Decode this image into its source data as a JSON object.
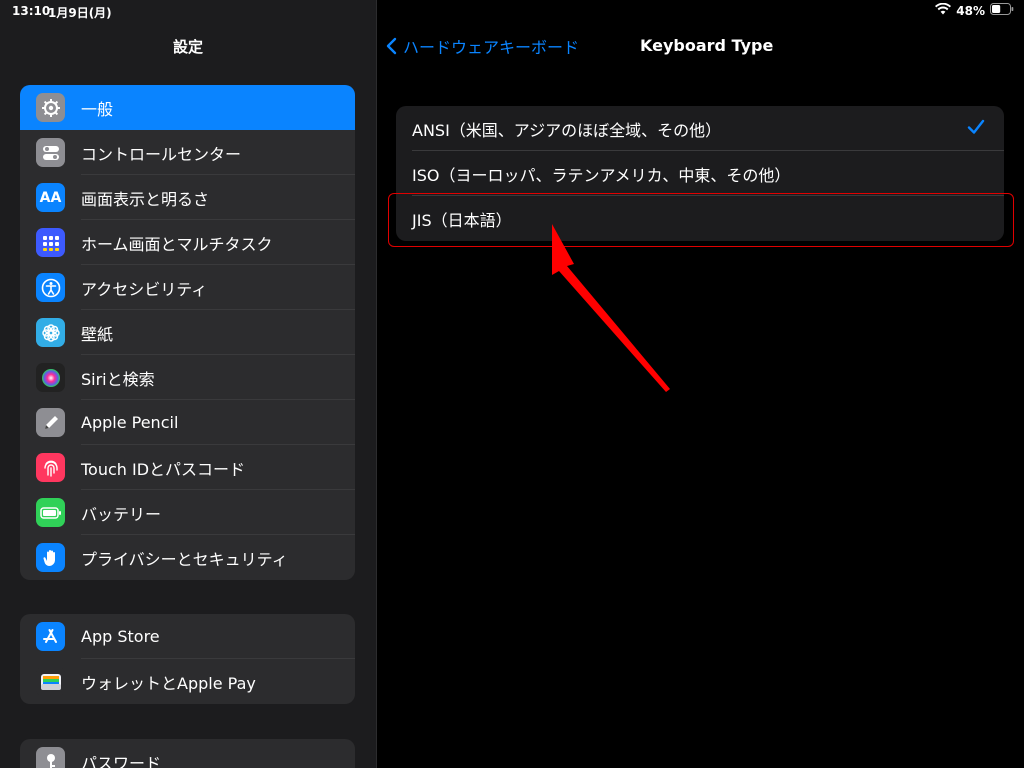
{
  "status": {
    "time": "13:10",
    "date": "1月9日(月)",
    "battery": "48%",
    "battery_level": 0.48
  },
  "sidebar": {
    "title": "設定",
    "groups": [
      {
        "items": [
          {
            "label": "一般",
            "icon": "gear-icon",
            "color": "#8e8e93",
            "selected": true
          },
          {
            "label": "コントロールセンター",
            "icon": "switches-icon",
            "color": "#8e8e93"
          },
          {
            "label": "画面表示と明るさ",
            "icon": "text-size-icon",
            "color": "#0a84ff",
            "icon_text": "AA"
          },
          {
            "label": "ホーム画面とマルチタスク",
            "icon": "home-grid-icon",
            "color": "#3d5afe"
          },
          {
            "label": "アクセシビリティ",
            "icon": "accessibility-icon",
            "color": "#0a84ff"
          },
          {
            "label": "壁紙",
            "icon": "flower-icon",
            "color": "#32ade6"
          },
          {
            "label": "Siriと検索",
            "icon": "siri-icon",
            "color": "#222222"
          },
          {
            "label": "Apple Pencil",
            "icon": "pencil-icon",
            "color": "#8e8e93"
          },
          {
            "label": "Touch IDとパスコード",
            "icon": "fingerprint-icon",
            "color": "#ff375f"
          },
          {
            "label": "バッテリー",
            "icon": "battery-icon",
            "color": "#30d158"
          },
          {
            "label": "プライバシーとセキュリティ",
            "icon": "hand-icon",
            "color": "#0a84ff"
          }
        ]
      },
      {
        "items": [
          {
            "label": "App Store",
            "icon": "app-store-icon",
            "color": "#0a84ff"
          },
          {
            "label": "ウォレットとApple Pay",
            "icon": "wallet-icon",
            "color": "#2c2c2e"
          }
        ]
      },
      {
        "items": [
          {
            "label": "パスワード",
            "icon": "key-icon",
            "color": "#8e8e93"
          }
        ]
      }
    ]
  },
  "nav": {
    "back_label": "ハードウェアキーボード",
    "title": "Keyboard Type"
  },
  "keyboard_types": [
    {
      "label": "ANSI（米国、アジアのほぼ全域、その他）",
      "checked": true
    },
    {
      "label": "ISO（ヨーロッパ、ラテンアメリカ、中東、その他）",
      "checked": false
    },
    {
      "label": "JIS（日本語）",
      "checked": false,
      "highlighted": true
    }
  ],
  "colors": {
    "accent": "#0a84ff",
    "annotation": "#ff0000"
  }
}
